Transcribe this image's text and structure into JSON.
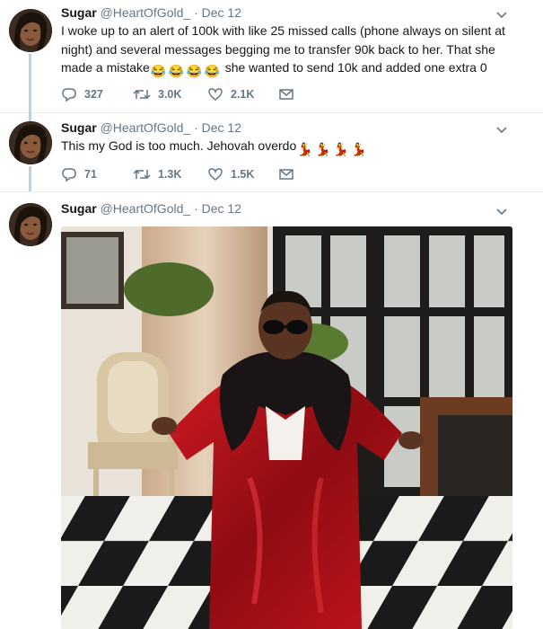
{
  "tweets": [
    {
      "name": "Sugar",
      "handle": "@HeartOfGold_",
      "dot": "·",
      "date": "Dec 12",
      "text": "I woke up to an alert of 100k with like 25 missed calls (phone always on silent at night) and several messages begging me to transfer 90k back to her. That she made a mistake",
      "emojis": [
        "😂",
        "😂",
        "😂",
        "😂"
      ],
      "text_after": " she wanted to send 10k and added one extra 0",
      "reply_count": "327",
      "retweet_count": "3.0K",
      "like_count": "2.1K"
    },
    {
      "name": "Sugar",
      "handle": "@HeartOfGold_",
      "dot": "·",
      "date": "Dec 12",
      "text": "This my God is too much. Jehovah overdo",
      "emojis": [
        "💃",
        "💃",
        "💃",
        "💃"
      ],
      "reply_count": "71",
      "retweet_count": "1.3K",
      "like_count": "1.5K"
    },
    {
      "name": "Sugar",
      "handle": "@HeartOfGold_",
      "dot": "·",
      "date": "Dec 12"
    }
  ],
  "icons": {
    "reply": "reply-icon",
    "retweet": "retweet-icon",
    "like": "heart-icon",
    "message": "envelope-icon",
    "caret": "chevron-down-icon"
  },
  "colors": {
    "icon_gray": "#657786",
    "divider": "#e6ecf0",
    "thread_line": "#c4cfd6"
  }
}
